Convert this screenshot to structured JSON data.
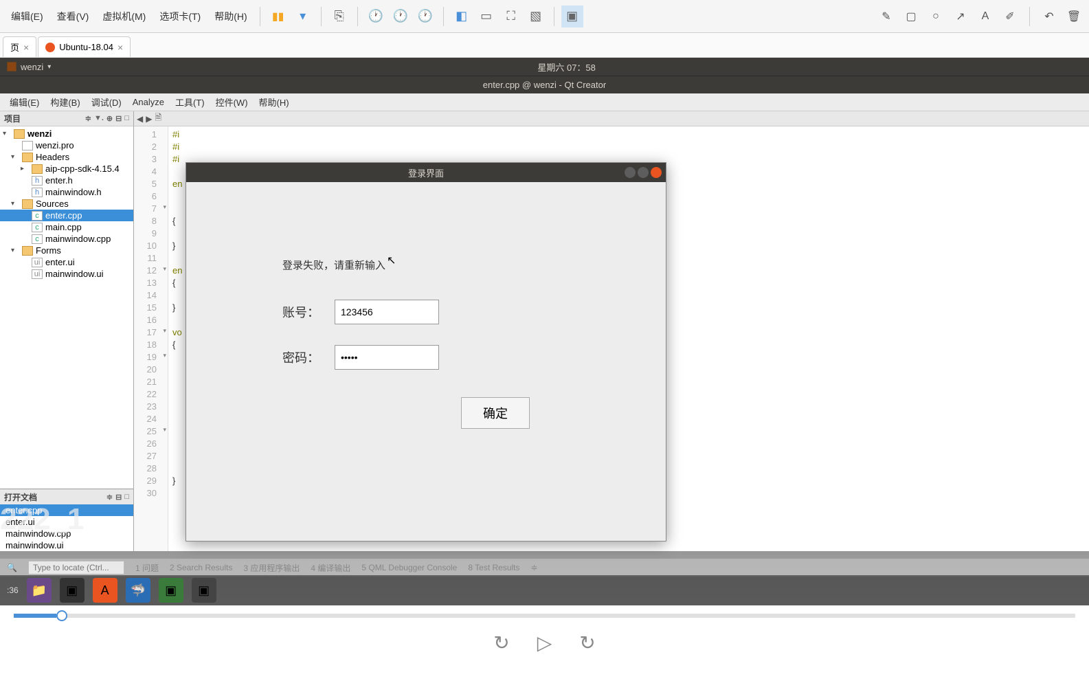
{
  "vmware": {
    "menus": [
      "编辑(E)",
      "查看(V)",
      "虚拟机(M)",
      "选项卡(T)",
      "帮助(H)"
    ],
    "tab_home": "页",
    "tab_ubuntu": "Ubuntu-18.04"
  },
  "panel": {
    "app_name": "wenzi",
    "time": "星期六 07：58"
  },
  "qtcreator": {
    "title": "enter.cpp @ wenzi - Qt Creator",
    "menus": [
      "编辑(E)",
      "构建(B)",
      "调试(D)",
      "Analyze",
      "工具(T)",
      "控件(W)",
      "帮助(H)"
    ]
  },
  "project_panel": {
    "title": "项目",
    "tree": {
      "root": "wenzi",
      "pro": "wenzi.pro",
      "headers": "Headers",
      "sdk": "aip-cpp-sdk-4.15.4",
      "enter_h": "enter.h",
      "mainwindow_h": "mainwindow.h",
      "sources": "Sources",
      "enter_cpp": "enter.cpp",
      "main_cpp": "main.cpp",
      "mainwindow_cpp": "mainwindow.cpp",
      "forms": "Forms",
      "enter_ui": "enter.ui",
      "mainwindow_ui": "mainwindow.ui"
    }
  },
  "open_docs": {
    "title": "打开文档",
    "items": [
      "enter.cpp",
      "enter.ui",
      "mainwindow.cpp",
      "mainwindow.ui"
    ]
  },
  "editor": {
    "lines": [
      "#i",
      "#i",
      "#i",
      "",
      "en",
      "",
      "",
      "{",
      "",
      "}",
      "",
      "en",
      "{",
      "",
      "}",
      "",
      "vo",
      "{",
      "",
      "",
      "",
      "",
      "",
      "",
      "",
      "",
      "",
      "",
      "}",
      ""
    ]
  },
  "dialog": {
    "title": "登录界面",
    "error": "登录失败，请重新输入",
    "account_label": "账号：",
    "account_value": "123456",
    "password_label": "密码：",
    "password_value": "•••••",
    "confirm": "确定"
  },
  "locator": {
    "placeholder": "Type to locate (Ctrl...",
    "tabs": [
      "1  问题",
      "2  Search Results",
      "3  应用程序输出",
      "4  编译输出",
      "5  QML Debugger Console",
      "8  Test Results"
    ]
  },
  "watermark": "222_1",
  "taskbar_time": ":36"
}
